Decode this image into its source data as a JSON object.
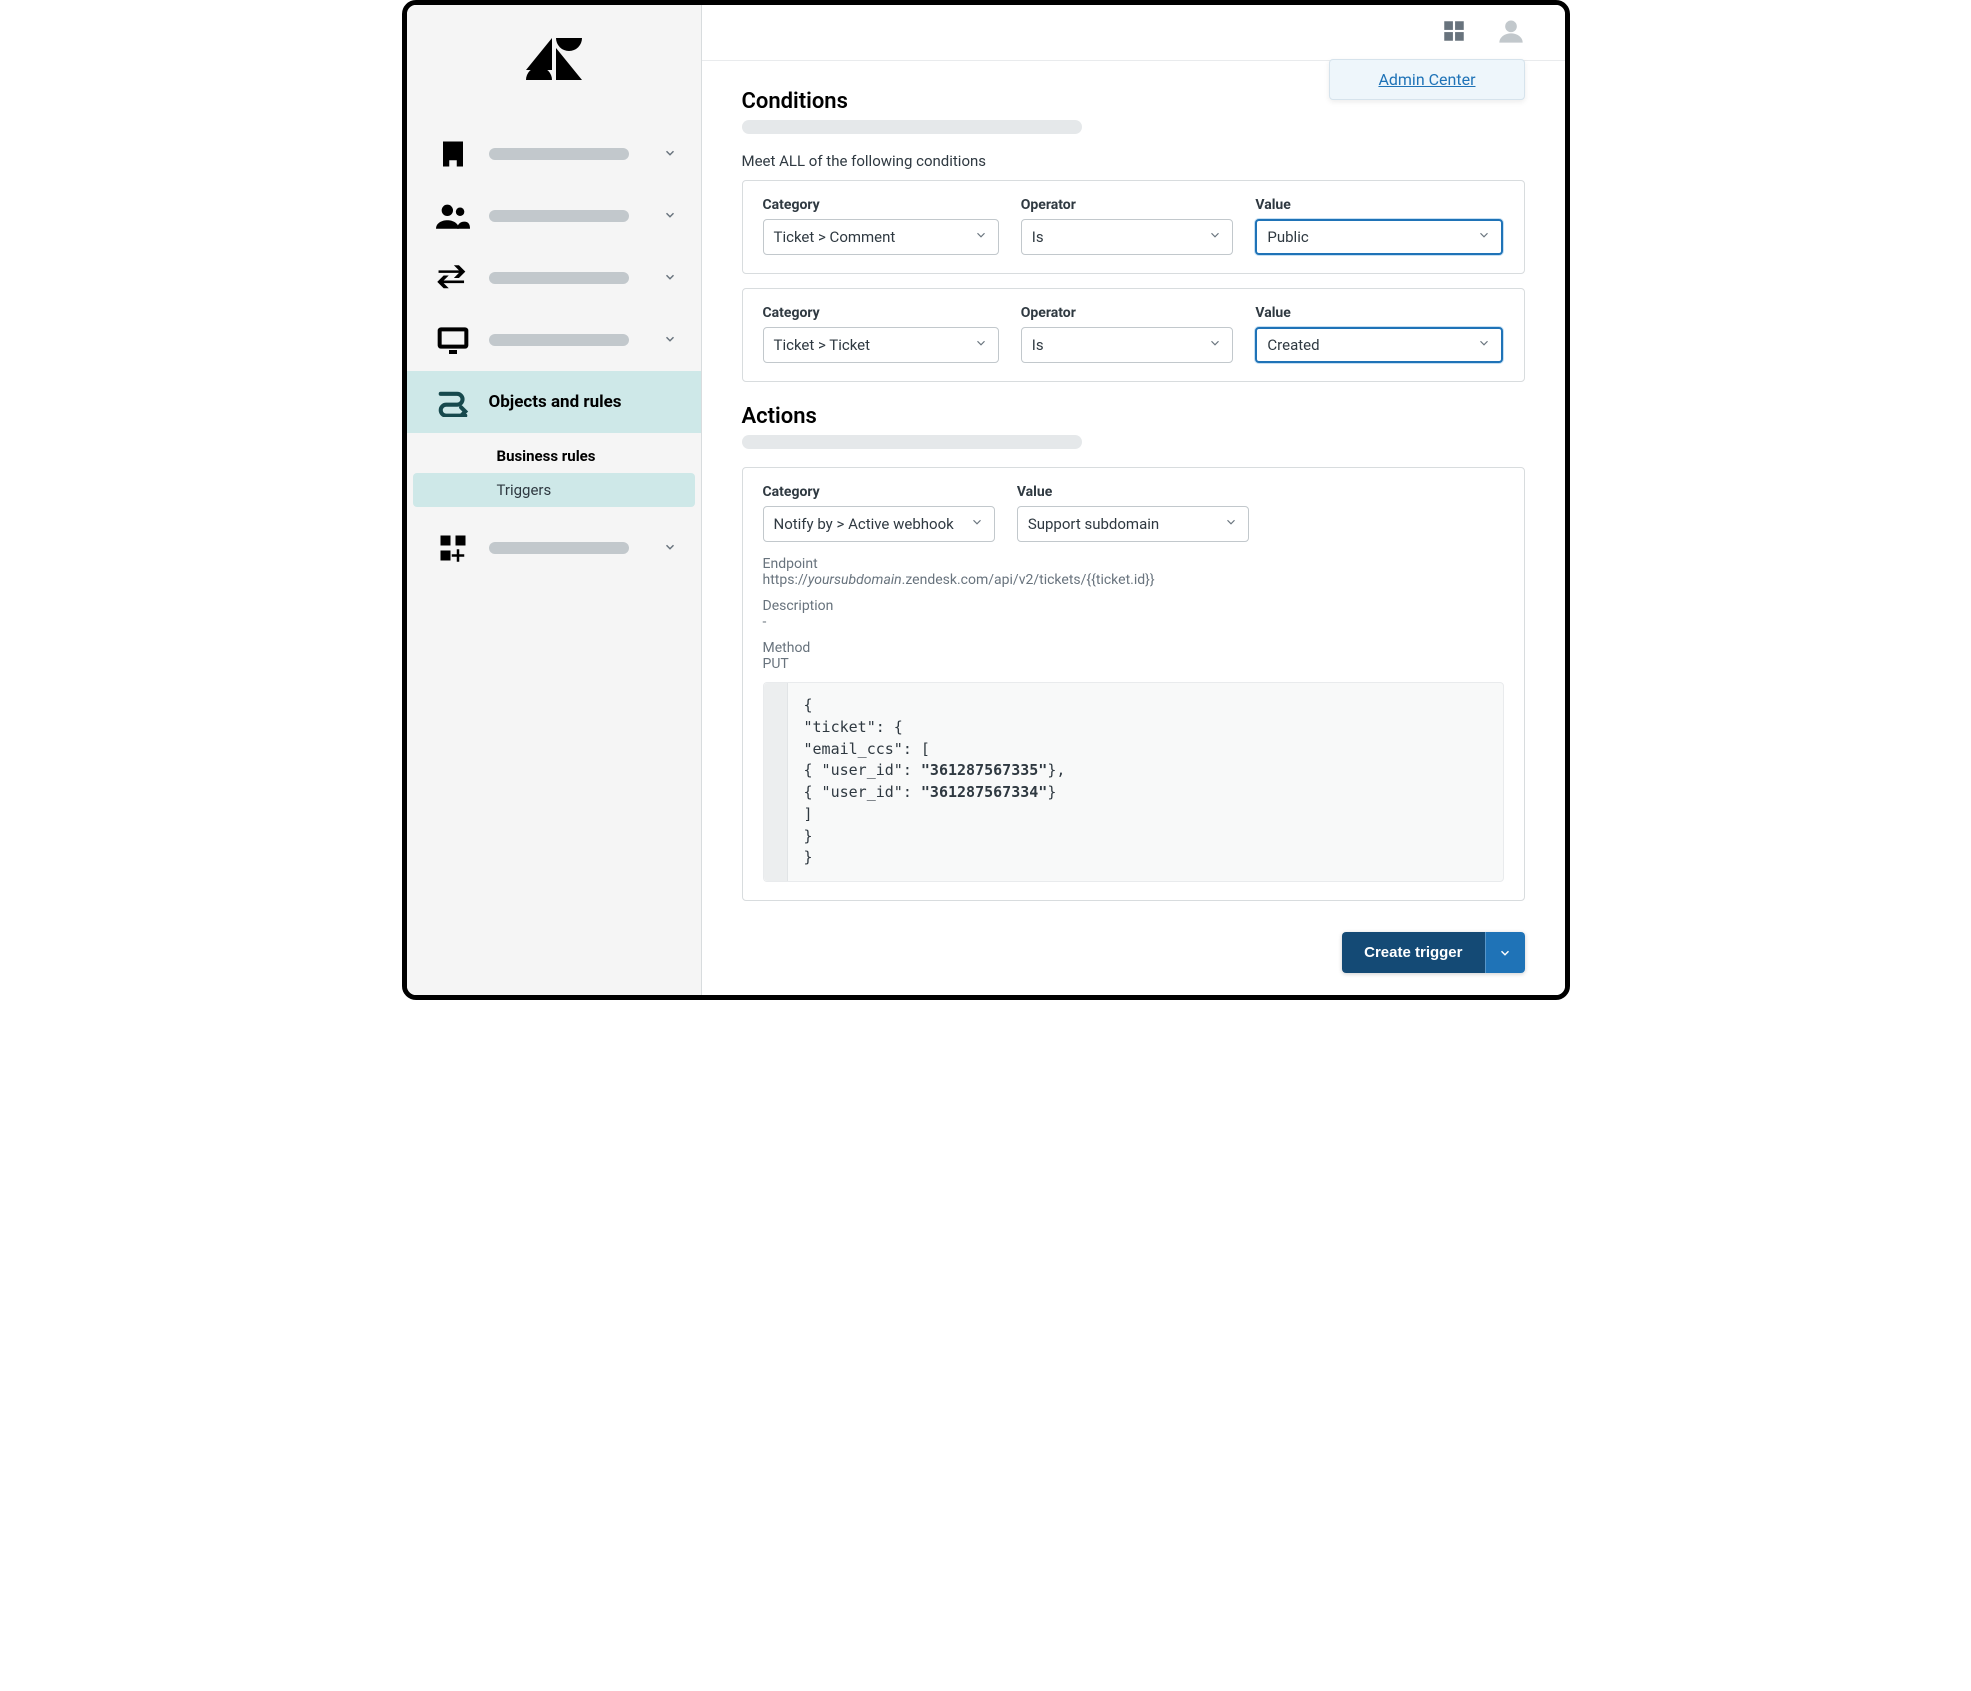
{
  "header": {
    "admin_center": "Admin Center"
  },
  "sidebar": {
    "active_label": "Objects and rules",
    "sub_header": "Business rules",
    "sub_active": "Triggers"
  },
  "conditions": {
    "title": "Conditions",
    "all_label": "Meet ALL of the following conditions",
    "labels": {
      "category": "Category",
      "operator": "Operator",
      "value": "Value"
    },
    "rows": [
      {
        "category": "Ticket > Comment",
        "operator": "Is",
        "value": "Public"
      },
      {
        "category": "Ticket > Ticket",
        "operator": "Is",
        "value": "Created"
      }
    ]
  },
  "actions": {
    "title": "Actions",
    "labels": {
      "category": "Category",
      "value": "Value"
    },
    "row": {
      "category": "Notify by > Active webhook",
      "value": "Support subdomain"
    },
    "endpoint_label": "Endpoint",
    "endpoint_prefix": "https://",
    "endpoint_em": "yoursubdomain",
    "endpoint_rest": ".zendesk.com/api/v2/tickets/{{ticket.id}}",
    "description_label": "Description",
    "description_value": "-",
    "method_label": "Method",
    "method_value": "PUT",
    "code_plain": "{\n\"ticket\": {\n\"email_ccs\": [\n{ \"user_id\": ",
    "code_b1": "\"361287567335\"",
    "code_mid": "},\n{ \"user_id\": ",
    "code_b2": "\"361287567334\"",
    "code_end": "}\n]\n}\n}"
  },
  "footer": {
    "create": "Create trigger"
  }
}
